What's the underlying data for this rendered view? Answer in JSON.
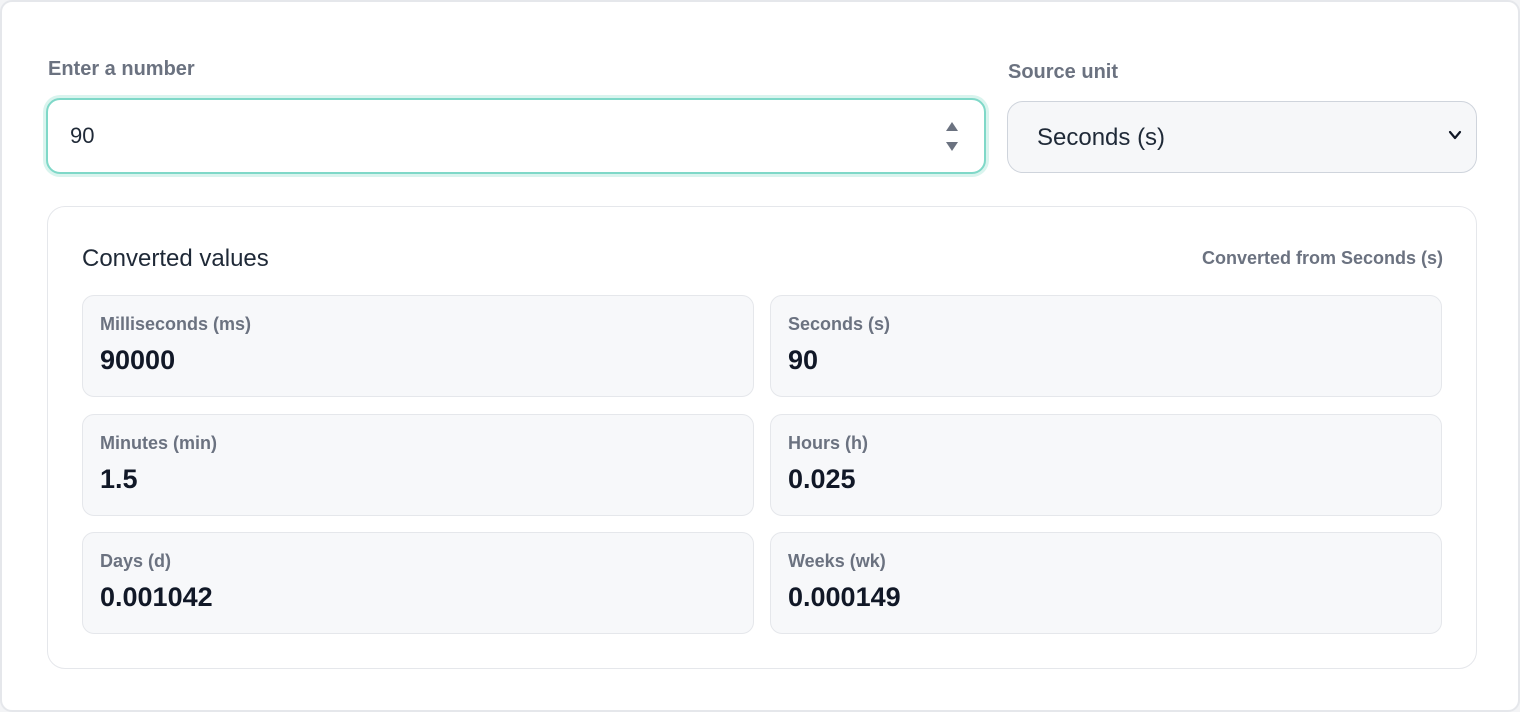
{
  "input": {
    "label": "Enter a number",
    "value": "90"
  },
  "source_unit": {
    "label": "Source unit",
    "selected": "Seconds (s)"
  },
  "results": {
    "title": "Converted values",
    "note": "Converted from Seconds (s)",
    "items": [
      {
        "unit": "Milliseconds (ms)",
        "value": "90000"
      },
      {
        "unit": "Seconds (s)",
        "value": "90"
      },
      {
        "unit": "Minutes (min)",
        "value": "1.5"
      },
      {
        "unit": "Hours (h)",
        "value": "0.025"
      },
      {
        "unit": "Days (d)",
        "value": "0.001042"
      },
      {
        "unit": "Weeks (wk)",
        "value": "0.000149"
      }
    ]
  },
  "colors": {
    "focus_border": "#7fd8c8",
    "label": "#6b7280",
    "value": "#111827"
  },
  "icons": {
    "spinner": "up-down-arrows-icon",
    "select": "chevron-down-icon"
  }
}
